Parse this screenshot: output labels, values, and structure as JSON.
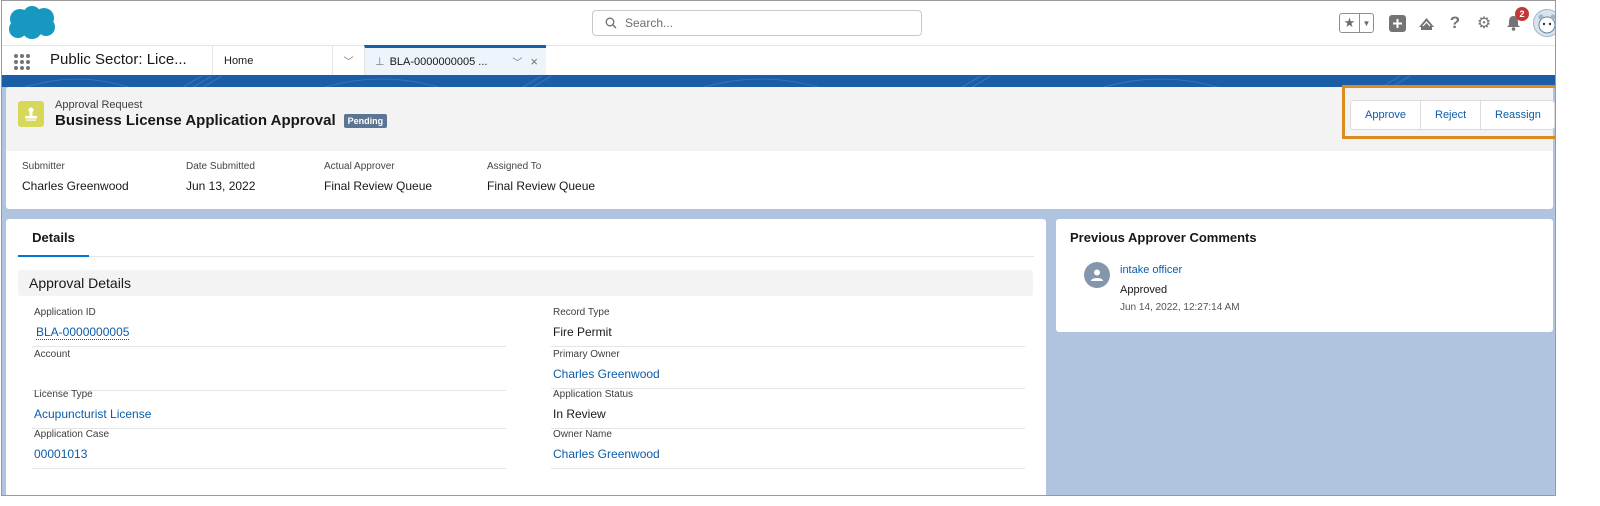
{
  "global_header": {
    "search_placeholder": "Search...",
    "notification_count": "2",
    "icons": [
      "favorites-star-icon",
      "favorites-dropdown-icon",
      "global-actions-plus-icon",
      "trailhead-icon",
      "help-icon",
      "setup-gear-icon",
      "notifications-bell-icon",
      "user-avatar"
    ]
  },
  "nav": {
    "app_name": "Public Sector: Lice...",
    "tabs": [
      {
        "label": "Home"
      },
      {
        "label": "BLA-0000000005 ...",
        "active": true
      }
    ]
  },
  "record": {
    "object_type": "Approval Request",
    "title": "Business License Application Approval",
    "status_badge": "Pending",
    "actions": [
      "Approve",
      "Reject",
      "Reassign"
    ],
    "highlights": [
      {
        "label": "Submitter",
        "value": "Charles Greenwood"
      },
      {
        "label": "Date Submitted",
        "value": "Jun 13, 2022"
      },
      {
        "label": "Actual Approver",
        "value": "Final Review Queue"
      },
      {
        "label": "Assigned To",
        "value": "Final Review Queue"
      }
    ]
  },
  "details": {
    "tab_label": "Details",
    "section_title": "Approval Details",
    "left_fields": [
      {
        "label": "Application ID",
        "value": "BLA-0000000005"
      },
      {
        "label": "Account",
        "value": ""
      },
      {
        "label": "License Type",
        "value": "Acupuncturist License"
      },
      {
        "label": "Application Case",
        "value": "00001013"
      }
    ],
    "right_fields": [
      {
        "label": "Record Type",
        "value": "Fire Permit"
      },
      {
        "label": "Primary Owner",
        "value": "Charles Greenwood"
      },
      {
        "label": "Application Status",
        "value": "In Review"
      },
      {
        "label": "Owner Name",
        "value": "Charles Greenwood"
      }
    ]
  },
  "comments": {
    "title": "Previous Approver Comments",
    "items": [
      {
        "author": "intake officer",
        "status": "Approved",
        "date": "Jun 14, 2022, 12:27:14 AM"
      }
    ]
  },
  "colors": {
    "brand_blue": "#1b5ea8",
    "link": "#0b5cab",
    "highlight_outline": "#dd8a1f",
    "record_icon": "#d7d85a",
    "badge_pending": "#5c7592",
    "notification_badge": "#c23934"
  }
}
